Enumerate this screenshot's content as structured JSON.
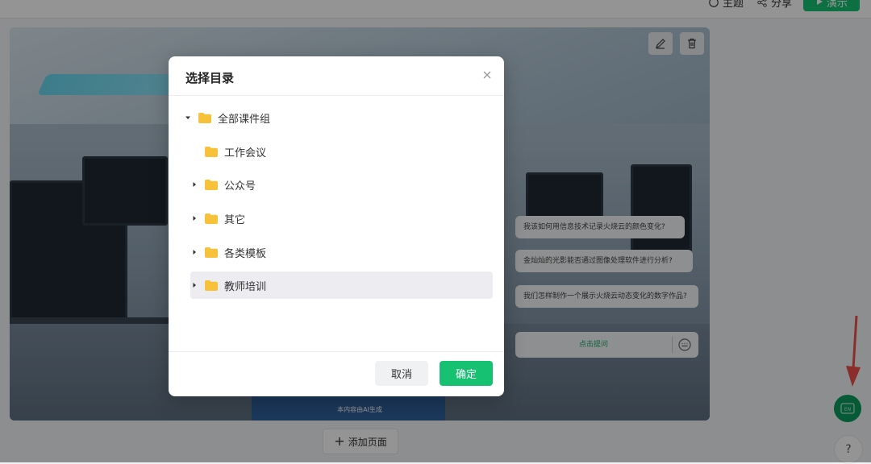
{
  "topbar": {
    "theme_label": "主题",
    "share_label": "分享",
    "present_label": "演示"
  },
  "canvas": {
    "ai_note": "本内容由AI生成",
    "questions": [
      "我该如何用信息技术记录火烧云的颜色变化?",
      "金灿灿的光影能否通过图像处理软件进行分析?",
      "我们怎样制作一个展示火烧云动态变化的数字作品?"
    ],
    "ask_label": "点击提问"
  },
  "add_page_label": "添加页面",
  "lang_label": "EN",
  "help_label": "?",
  "dialog": {
    "title": "选择目录",
    "tree": [
      {
        "label": "全部课件组",
        "level": 0,
        "expanded": true,
        "has_children": true,
        "selected": false
      },
      {
        "label": "工作会议",
        "level": 1,
        "expanded": false,
        "has_children": false,
        "selected": false
      },
      {
        "label": "公众号",
        "level": 1,
        "expanded": false,
        "has_children": true,
        "selected": false
      },
      {
        "label": "其它",
        "level": 1,
        "expanded": false,
        "has_children": true,
        "selected": false
      },
      {
        "label": "各类模板",
        "level": 1,
        "expanded": false,
        "has_children": true,
        "selected": false
      },
      {
        "label": "教师培训",
        "level": 1,
        "expanded": false,
        "has_children": true,
        "selected": true
      }
    ],
    "cancel_label": "取消",
    "confirm_label": "确定"
  },
  "colors": {
    "accent": "#16c172",
    "folder": "#f8c13a",
    "annotation_arrow": "#f0504a"
  }
}
